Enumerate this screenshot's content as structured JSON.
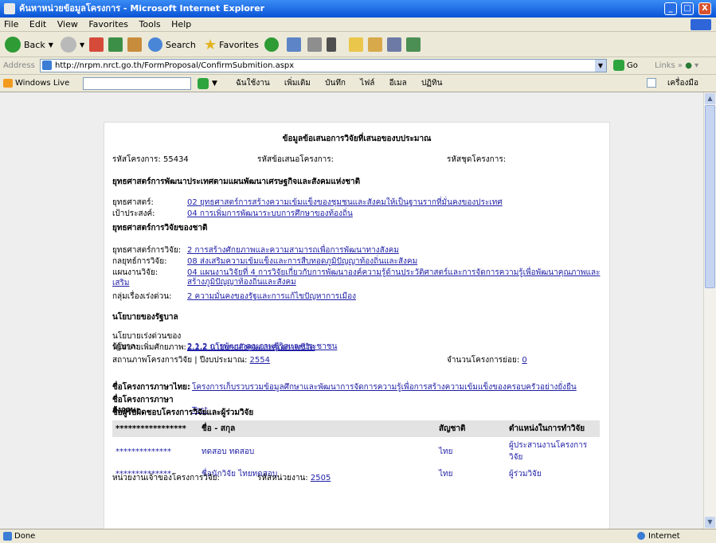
{
  "window": {
    "title": "ค้นหาหน่วยข้อมูลโครงการ - Microsoft Internet Explorer",
    "minimize": "_",
    "maximize": "□",
    "close": "X"
  },
  "menubar": [
    "File",
    "Edit",
    "View",
    "Favorites",
    "Tools",
    "Help"
  ],
  "toolbar": {
    "back_label": "Back",
    "search_label": "Search",
    "favorites_label": "Favorites"
  },
  "address": {
    "label": "Address",
    "url": "http://nrpm.nrct.go.th/FormProposal/ConfirmSubmition.aspx",
    "go_label": "Go",
    "links_label": "Links"
  },
  "windows_live": {
    "logo": "Windows Live",
    "menu": [
      "ฉันใช้งาน",
      "เพิ่มเติม",
      "บันทึก",
      "ไฟล์",
      "อีเมล",
      "ปฏิทิน"
    ],
    "right_label": "เครื่องมือ"
  },
  "page": {
    "title": "ข้อมูลข้อเสนอการวิจัยที่เสนอของบประมาณ",
    "project_code_label": "รหัสโครงการ:",
    "project_code_value": "55434",
    "proposal_code_label": "รหัสข้อเสนอโครงการ:",
    "budget_code_label": "รหัสชุดโครงการ:",
    "strategy_heading": "ยุทธศาสตร์การพัฒนาประเทศตามแผนพัฒนาเศรษฐกิจและสังคมแห่งชาติ",
    "strategy": [
      {
        "label": "ยุทธศาสตร์:",
        "value": "02 ยุทธศาสตร์การสร้างความเข้มแข็งของชุมชนและสังคมให้เป็นฐานรากที่มั่นคงของประเทศ"
      },
      {
        "label": "เป้าประสงค์:",
        "value": "04 การเพิ่มการพัฒนาระบบการศึกษาของท้องถิ่น"
      }
    ],
    "research_heading": "ยุทธศาสตร์การวิจัยของชาติ",
    "research": [
      {
        "label": "ยุทธศาสตร์การวิจัย:",
        "value": "2 การสร้างศักยภาพและความสามารถเพื่อการพัฒนาทางสังคม"
      },
      {
        "label": "กลยุทธ์การวิจัย:",
        "value": "08 ส่งเสริมความเข้มแข็งและการสืบทอดภูมิปัญญาท้องถิ่นและสังคม"
      },
      {
        "label": "แผนงานวิจัย:",
        "value": "04 แผนงานวิจัยที่ 4 การวิจัยเกี่ยวกับการพัฒนาองค์ความรู้ด้านประวัติศาสตร์และการจัดการความรู้เพื่อพัฒนาคุณภาพและเสริม",
        "value2": "สร้างภูมิปัญญาท้องถิ่นและสังคม"
      },
      {
        "label": "กลุ่มเรื่องเร่งด่วน:",
        "value": "2 ความมั่นคงของรัฐและการแก้ไขปัญหาการเมือง"
      }
    ],
    "policy_heading": "นโยบายของรัฐบาล",
    "policy": [
      {
        "label": "นโยบายเร่งด่วนของรัฐบาล:",
        "value": "2.1.2 การพัฒนาคุณภาพชีวิตและประชาชน"
      },
      {
        "label": "นโยบายเพิ่มศักยภาพ:",
        "value": "2.2.2 นโยบายสังคมและคุณภาพชีวิต"
      }
    ],
    "status_label": "สถานภาพโครงการวิจัย | ปีงบประมาณ:",
    "status_year": "2554",
    "duration_label": "จำนวนโครงการย่อย:",
    "duration_value": "0",
    "thai_name_label": "ชื่อโครงการภาษาไทย:",
    "thai_name_value": "โครงการเก็บรวบรวมข้อมูลศึกษาและพัฒนาการจัดการความรู้เพื่อการสร้างความเข้มแข็งของครอบครัวอย่างยั่งยืน",
    "eng_name_label": "ชื่อโครงการภาษาอังกฤษ:",
    "eng_name_value": "Test",
    "personnel_heading": "ชื่อผู้รับผิดชอบโครงการวิจัยและผู้ร่วมวิจัย",
    "table": {
      "headers": [
        "*****************",
        "ชื่อ - สกุล",
        "สัญชาติ",
        "ตำแหน่งในการทำวิจัย"
      ],
      "rows": [
        {
          "id": "**************",
          "name": "ทดสอบ ทดสอบ",
          "nationality": "ไทย",
          "role": "ผู้ประสานงานโครงการวิจัย"
        },
        {
          "id": "**************",
          "name": "ชื่อนักวิจัย ไทยทดสอบ",
          "nationality": "ไทย",
          "role": "ผู้ร่วมวิจัย"
        }
      ]
    },
    "agency_label": "หน่วยงานเจ้าของโครงการวิจัย:",
    "agency_code_label": "รหัสหน่วยงาน:",
    "agency_code_value": "2505"
  },
  "statusbar": {
    "done": "Done",
    "zone": "Internet"
  }
}
